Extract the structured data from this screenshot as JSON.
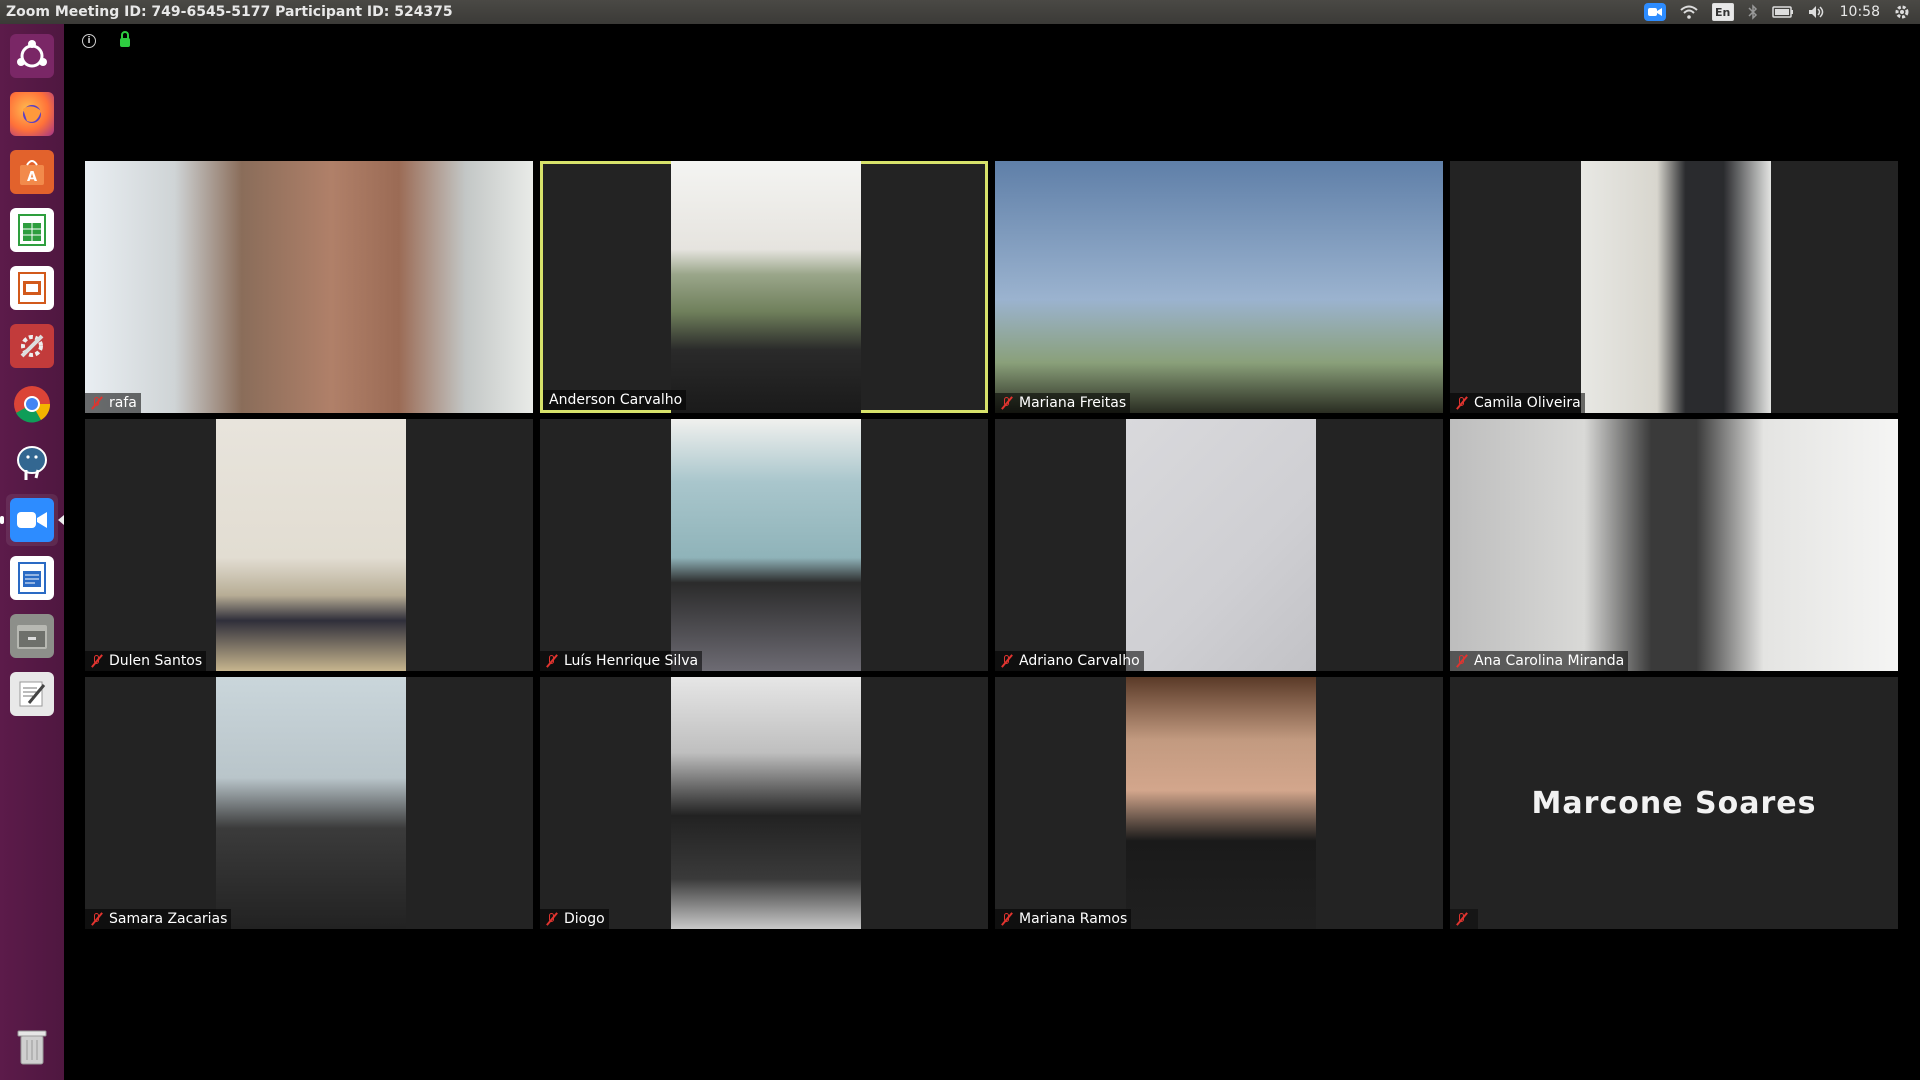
{
  "window": {
    "title": "Zoom Meeting ID: 749-6545-5177 Participant ID: 524375"
  },
  "system_tray": {
    "icons": [
      "zoom-icon",
      "wifi-icon",
      "keyboard-layout-icon",
      "bluetooth-icon",
      "battery-icon",
      "volume-icon",
      "settings-gear-icon"
    ],
    "keyboard_layout": "En",
    "clock": "10:58"
  },
  "launcher": {
    "items": [
      {
        "name": "ubuntu-dash",
        "icon": "ubuntu-logo-icon",
        "color": "#e95420"
      },
      {
        "name": "firefox",
        "icon": "firefox-icon",
        "color": "#ff7139"
      },
      {
        "name": "software-center",
        "icon": "software-center-icon",
        "color": "#e2622c"
      },
      {
        "name": "libreoffice-calc",
        "icon": "spreadsheet-icon",
        "color": "#2e9e3e"
      },
      {
        "name": "libreoffice-impress",
        "icon": "presentation-icon",
        "color": "#d2591b"
      },
      {
        "name": "system-settings",
        "icon": "settings-tools-icon",
        "color": "#c23b3b"
      },
      {
        "name": "chrome",
        "icon": "chrome-icon",
        "color": "#4285f4"
      },
      {
        "name": "pgadmin",
        "icon": "elephant-icon",
        "color": "#336791"
      },
      {
        "name": "zoom",
        "icon": "zoom-icon",
        "color": "#2d8cff",
        "active": true
      },
      {
        "name": "libreoffice-writer",
        "icon": "document-icon",
        "color": "#2a6ac4"
      },
      {
        "name": "file-manager",
        "icon": "files-icon",
        "color": "#8d8f8a"
      },
      {
        "name": "text-editor",
        "icon": "text-editor-icon",
        "color": "#dcdcdc"
      },
      {
        "name": "trash",
        "icon": "trash-icon",
        "color": "#bdbdbd"
      }
    ]
  },
  "meeting": {
    "top_icons": [
      "info-icon",
      "encryption-lock-icon"
    ],
    "participants": [
      {
        "name": "rafa",
        "muted": true,
        "video": "full",
        "active_speaker": false
      },
      {
        "name": "Anderson Carvalho",
        "muted": false,
        "video": "center",
        "active_speaker": true
      },
      {
        "name": "Mariana Freitas",
        "muted": true,
        "video": "full",
        "active_speaker": false
      },
      {
        "name": "Camila Oliveira",
        "muted": true,
        "video": "center",
        "active_speaker": false
      },
      {
        "name": "Dulen Santos",
        "muted": true,
        "video": "center",
        "active_speaker": false
      },
      {
        "name": "Luís Henrique Silva",
        "muted": true,
        "video": "center",
        "active_speaker": false
      },
      {
        "name": "Adriano Carvalho",
        "muted": true,
        "video": "center",
        "active_speaker": false
      },
      {
        "name": "Ana Carolina Miranda",
        "muted": true,
        "video": "full",
        "active_speaker": false
      },
      {
        "name": "Samara Zacarias",
        "muted": true,
        "video": "center",
        "active_speaker": false
      },
      {
        "name": "Diogo",
        "muted": true,
        "video": "center",
        "active_speaker": false
      },
      {
        "name": "Mariana Ramos",
        "muted": true,
        "video": "center",
        "active_speaker": false
      },
      {
        "name": "Marcone Soares",
        "muted": true,
        "video": "off",
        "active_speaker": false
      }
    ]
  },
  "colors": {
    "active_speaker_border": "#d7e26a",
    "mute_icon": "#e0342f",
    "tile_background": "#232323"
  }
}
